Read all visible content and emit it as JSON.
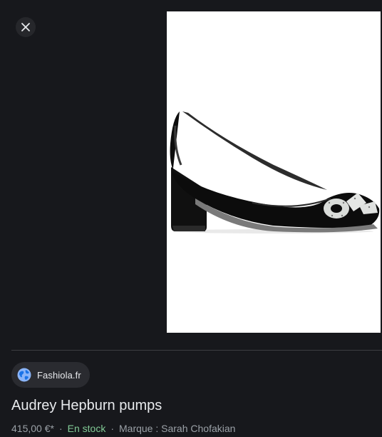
{
  "viewer": {
    "close_icon": "close-icon"
  },
  "source": {
    "icon": "globe-icon",
    "name": "Fashiola.fr"
  },
  "product": {
    "title": "Audrey Hepburn pumps",
    "price": "415,00 €*",
    "separator": "·",
    "stock": "En stock",
    "brand": "Marque : Sarah Chofakian"
  },
  "colors": {
    "background": "#17181c",
    "stock_green": "#81c995",
    "secondary_text": "#9aa0a6"
  }
}
